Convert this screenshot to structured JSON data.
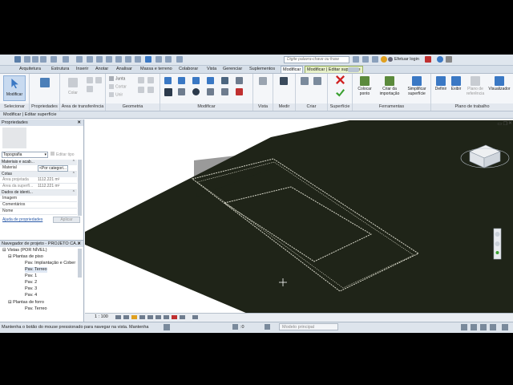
{
  "quick_access": {
    "search_placeholder": "Digite palavra-chave ou frase",
    "login_label": "Efetuar login"
  },
  "tabs": [
    "Arquitetura",
    "Estrutura",
    "Inserir",
    "Anotar",
    "Analisar",
    "Massa e terreno",
    "Colaborar",
    "Vista",
    "Gerenciar",
    "Suplementos",
    "Modificar",
    "Modificar | Editar superfície"
  ],
  "ribbon": {
    "modify_button": "Modificar",
    "properties_button": "Propriedades",
    "panels": {
      "selecionar": "Selecionar",
      "propriedades": "Propriedades",
      "area_transferencia": "Área de transferência",
      "geometria": "Geometria",
      "modificar": "Modificar",
      "vista": "Vista",
      "medir": "Medir",
      "criar": "Criar",
      "superficie": "Superfície",
      "ferramentas": "Ferramentas",
      "plano_trabalho": "Plano de trabalho"
    },
    "clipboard": {
      "colar": "Colar"
    },
    "geometry": {
      "junta": "Junta",
      "cortar": "Cortar",
      "unir": "Unir"
    },
    "tools": {
      "colocar_ponto": "Colocar ponto",
      "criar_importacao": "Criar da importação",
      "simplificar": "Simplificar superfície"
    },
    "workplane": {
      "definir": "Definir",
      "exibir": "Exibir",
      "plano_ref": "Plano de referência",
      "visualizador": "Visualizador"
    }
  },
  "options_bar": "Modificar | Editar superfície",
  "properties": {
    "title": "Propriedades",
    "type": "Topografia",
    "edit_type": "Editar tipo",
    "sections": [
      "Materiais e acab...",
      "Cotas",
      "Dados de identi..."
    ],
    "rows": [
      {
        "k": "Material",
        "v": "<Por categori..."
      },
      {
        "k": "Área projetada",
        "v": "1112.221 m²"
      },
      {
        "k": "Área da superfí...",
        "v": "1112.221 m²"
      },
      {
        "k": "Imagem",
        "v": ""
      },
      {
        "k": "Comentários",
        "v": ""
      },
      {
        "k": "Nome",
        "v": ""
      }
    ],
    "help_link": "Ajuda de propriedades",
    "apply_button": "Aplicar"
  },
  "project_browser": {
    "title": "Navegador de projeto - PROJETO CA...",
    "tree": [
      {
        "label": "Vistas (POR NÍVEL)",
        "level": 0
      },
      {
        "label": "Plantas de piso",
        "level": 1
      },
      {
        "label": "Pav. Implantação e Cober",
        "level": 2
      },
      {
        "label": "Pav. Terreo",
        "level": 2
      },
      {
        "label": "Pav. 1",
        "level": 2
      },
      {
        "label": "Pav. 2",
        "level": 2
      },
      {
        "label": "Pav. 3",
        "level": 2
      },
      {
        "label": "Pav. 4",
        "level": 2
      },
      {
        "label": "Plantas de forro",
        "level": 1
      },
      {
        "label": "Pav. Terreo",
        "level": 2
      }
    ]
  },
  "view_control_bar": {
    "scale": "1 : 100"
  },
  "status_bar": {
    "message": "Mantenha o botão do mouse pressionado para navegar na vista. Mantenha",
    "zero": ":0",
    "model": "Modelo principal"
  },
  "colors": {
    "surface": "#1f2418",
    "wall": "#9a9a9a",
    "accent": "#3a78c4"
  }
}
